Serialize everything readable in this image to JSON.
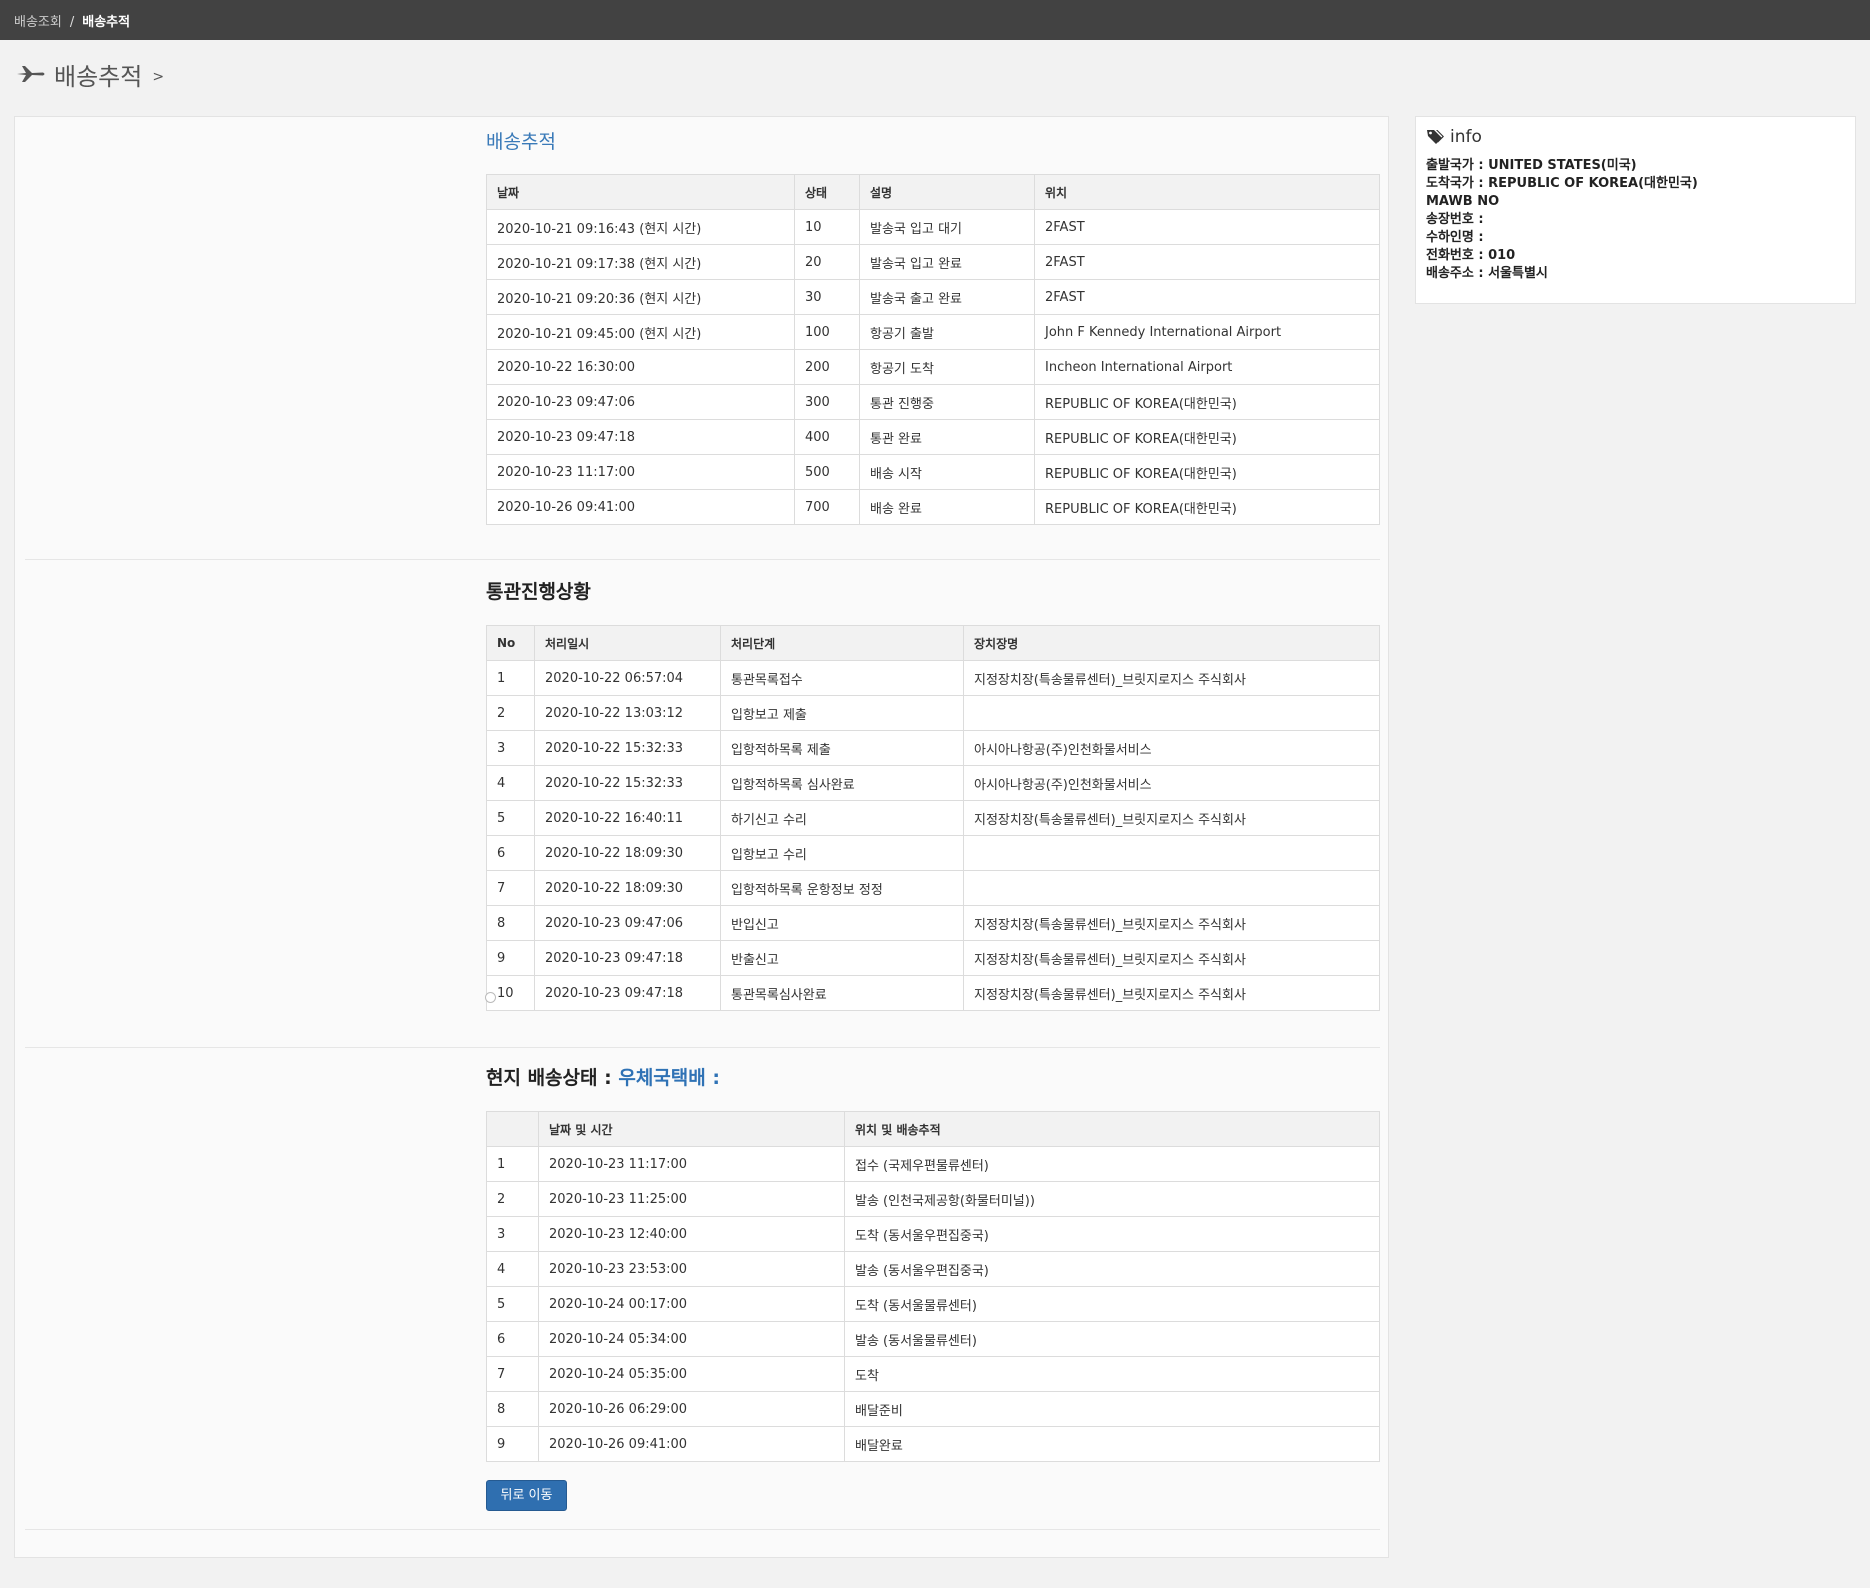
{
  "breadcrumb": {
    "parent": "배송조회",
    "current": "배송추적"
  },
  "page_title": {
    "text": "배송추적",
    "suffix": ">"
  },
  "info": {
    "title": "info",
    "origin": "출발국가 : UNITED STATES(미국)",
    "destination": "도착국가 : REPUBLIC OF KOREA(대한민국)",
    "mawb": "MAWB NO",
    "tracking_no": "송장번호 :",
    "consignee": "수하인명 :",
    "phone": "전화번호 : 010",
    "address": "배송주소 : 서울특별시"
  },
  "tracking": {
    "title": "배송추적",
    "headers": [
      "날짜",
      "상태",
      "설명",
      "위치"
    ],
    "rows": [
      [
        "2020-10-21 09:16:43 (현지 시간)",
        "10",
        "발송국 입고 대기",
        "2FAST"
      ],
      [
        "2020-10-21 09:17:38 (현지 시간)",
        "20",
        "발송국 입고 완료",
        "2FAST"
      ],
      [
        "2020-10-21 09:20:36 (현지 시간)",
        "30",
        "발송국 출고 완료",
        "2FAST"
      ],
      [
        "2020-10-21 09:45:00 (현지 시간)",
        "100",
        "항공기 출발",
        "John F Kennedy International Airport"
      ],
      [
        "2020-10-22 16:30:00",
        "200",
        "항공기 도착",
        "Incheon International Airport"
      ],
      [
        "2020-10-23 09:47:06",
        "300",
        "통관 진행중",
        "REPUBLIC OF KOREA(대한민국)"
      ],
      [
        "2020-10-23 09:47:18",
        "400",
        "통관 완료",
        "REPUBLIC OF KOREA(대한민국)"
      ],
      [
        "2020-10-23 11:17:00",
        "500",
        "배송 시작",
        "REPUBLIC OF KOREA(대한민국)"
      ],
      [
        "2020-10-26 09:41:00",
        "700",
        "배송 완료",
        "REPUBLIC OF KOREA(대한민국)"
      ]
    ]
  },
  "customs": {
    "title": "통관진행상황",
    "headers": [
      "No",
      "처리일시",
      "처리단계",
      "장치장명"
    ],
    "rows": [
      [
        "1",
        "2020-10-22 06:57:04",
        "통관목록접수",
        "지정장치장(특송물류센터)_브릿지로지스 주식회사"
      ],
      [
        "2",
        "2020-10-22 13:03:12",
        "입항보고 제출",
        ""
      ],
      [
        "3",
        "2020-10-22 15:32:33",
        "입항적하목록 제출",
        "아시아나항공(주)인천화물서비스"
      ],
      [
        "4",
        "2020-10-22 15:32:33",
        "입항적하목록 심사완료",
        "아시아나항공(주)인천화물서비스"
      ],
      [
        "5",
        "2020-10-22 16:40:11",
        "하기신고 수리",
        "지정장치장(특송물류센터)_브릿지로지스 주식회사"
      ],
      [
        "6",
        "2020-10-22 18:09:30",
        "입항보고 수리",
        ""
      ],
      [
        "7",
        "2020-10-22 18:09:30",
        "입항적하목록 운항정보 정정",
        ""
      ],
      [
        "8",
        "2020-10-23 09:47:06",
        "반입신고",
        "지정장치장(특송물류센터)_브릿지로지스 주식회사"
      ],
      [
        "9",
        "2020-10-23 09:47:18",
        "반출신고",
        "지정장치장(특송물류센터)_브릿지로지스 주식회사"
      ],
      [
        "10",
        "2020-10-23 09:47:18",
        "통관목록심사완료",
        "지정장치장(특송물류센터)_브릿지로지스 주식회사"
      ]
    ]
  },
  "local": {
    "title_prefix": "현지 배송상태 :",
    "carrier": "우체국택배 :",
    "headers": [
      "",
      "날짜 및 시간",
      "위치 및 배송추적"
    ],
    "rows": [
      [
        "1",
        "2020-10-23 11:17:00",
        "접수 (국제우편물류센터)"
      ],
      [
        "2",
        "2020-10-23 11:25:00",
        "발송 (인천국제공항(화물터미널))"
      ],
      [
        "3",
        "2020-10-23 12:40:00",
        "도착 (동서울우편집중국)"
      ],
      [
        "4",
        "2020-10-23 23:53:00",
        "발송 (동서울우편집중국)"
      ],
      [
        "5",
        "2020-10-24 00:17:00",
        "도착 (동서울물류센터)"
      ],
      [
        "6",
        "2020-10-24 05:34:00",
        "발송 (동서울물류센터)"
      ],
      [
        "7",
        "2020-10-24 05:35:00",
        "도착"
      ],
      [
        "8",
        "2020-10-26 06:29:00",
        "배달준비"
      ],
      [
        "9",
        "2020-10-26 09:41:00",
        "배달완료"
      ]
    ]
  },
  "back_button": "뒤로 이동"
}
